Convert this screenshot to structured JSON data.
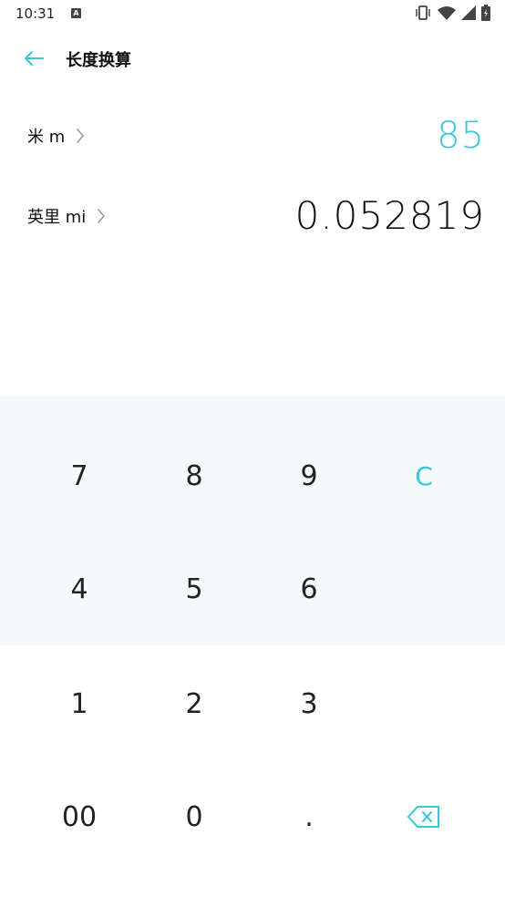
{
  "status": {
    "time": "10:31",
    "a_badge": "A"
  },
  "header": {
    "title": "长度换算"
  },
  "units": [
    {
      "label": "米 m",
      "value": "85"
    },
    {
      "label": "英里 mi",
      "value": "0.052819"
    }
  ],
  "keypad": {
    "keys": [
      "7",
      "8",
      "9",
      "C",
      "4",
      "5",
      "6",
      "1",
      "2",
      "3",
      "00",
      "0",
      "."
    ]
  },
  "colors": {
    "accent": "#35C9D6",
    "keypad_bg": "#F5FAFC"
  }
}
